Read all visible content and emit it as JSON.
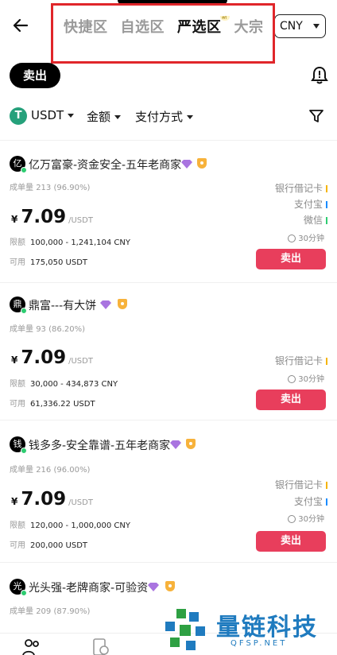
{
  "header": {
    "tabs": [
      {
        "label": "快捷区",
        "active": false
      },
      {
        "label": "自选区",
        "active": false
      },
      {
        "label": "严选区",
        "active": true,
        "badge": "新"
      },
      {
        "label": "大宗",
        "active": false
      }
    ],
    "currency": "CNY",
    "highlight_color": "#e0262a"
  },
  "action": {
    "sell_label": "卖出"
  },
  "filters": {
    "coin": "USDT",
    "coin_logo": "T",
    "amount": "金额",
    "payment": "支付方式"
  },
  "merchants": [
    {
      "avatar_char": "亿",
      "name": "亿万富豪-资金安全-五年老商家",
      "orders_label": "成单量",
      "orders": "213 (96.90%)",
      "currency_symbol": "¥",
      "price": "7.09",
      "unit": "/USDT",
      "limit_label": "限额",
      "limit": "100,000 - 1,241,104 CNY",
      "available_label": "可用",
      "available": "175,050 USDT",
      "payments": [
        {
          "name": "银行借记卡",
          "color": "#f5b400"
        },
        {
          "name": "支付宝",
          "color": "#1a8cff"
        },
        {
          "name": "微信",
          "color": "#2ecc71"
        }
      ],
      "time_limit": "30分钟",
      "button": "卖出"
    },
    {
      "avatar_char": "鼎",
      "name": "鼎富---有大饼",
      "orders_label": "成单量",
      "orders": "93 (86.20%)",
      "currency_symbol": "¥",
      "price": "7.09",
      "unit": "/USDT",
      "limit_label": "限额",
      "limit": "30,000 - 434,873 CNY",
      "available_label": "可用",
      "available": "61,336.22 USDT",
      "payments": [
        {
          "name": "银行借记卡",
          "color": "#f5b400"
        }
      ],
      "time_limit": "30分钟",
      "button": "卖出"
    },
    {
      "avatar_char": "钱",
      "name": "钱多多-安全靠谱-五年老商家",
      "orders_label": "成单量",
      "orders": "216 (96.00%)",
      "currency_symbol": "¥",
      "price": "7.09",
      "unit": "/USDT",
      "limit_label": "限额",
      "limit": "120,000 - 1,000,000 CNY",
      "available_label": "可用",
      "available": "200,000 USDT",
      "payments": [
        {
          "name": "银行借记卡",
          "color": "#f5b400"
        },
        {
          "name": "支付宝",
          "color": "#1a8cff"
        }
      ],
      "time_limit": "30分钟",
      "button": "卖出"
    },
    {
      "avatar_char": "光",
      "name": "光头强-老牌商家-可验资",
      "orders_label": "成单量",
      "orders": "209 (87.90%)"
    }
  ],
  "watermark": {
    "text": "量链科技",
    "url": "QFSP.NET"
  },
  "colors": {
    "sell_button": "#e83e5c",
    "online_dot": "#2ecc71",
    "usdt": "#26a17b",
    "watermark": "#1f7bbf"
  }
}
